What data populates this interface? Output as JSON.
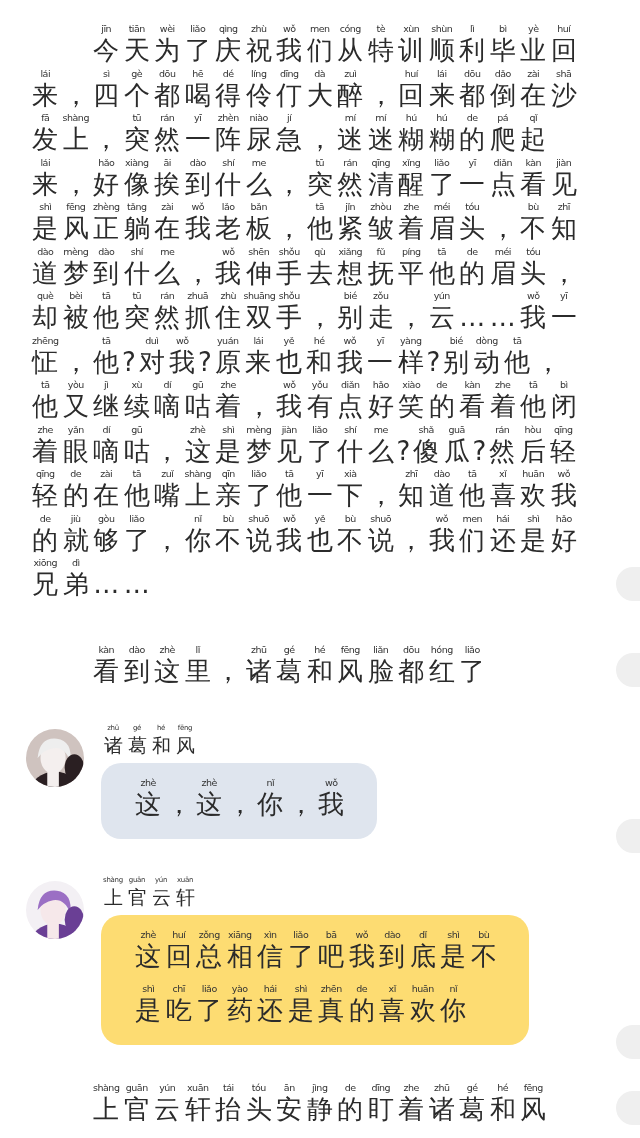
{
  "blocks": [
    {
      "kind": "narration",
      "lines": [
        {
          "pinyin": "jīn tiān wèi liǎo qìng zhù wǒ men cóng tè xùn shùn lì bì yè huí",
          "text": "今天为了庆祝我们从特训顺利毕业回"
        },
        {
          "pinyin": "lái sì gè dōu hē dé líng dīng dà zuì huí lái dōu dǎo zài shā",
          "text": "来，四个都喝得伶仃大醉，回来都倒在沙"
        },
        {
          "pinyin": "fā shàng tū rán yī zhèn niào jí mí mí hú hú de pá qǐ",
          "text": "发上，突然一阵尿急，迷迷糊糊的爬起"
        },
        {
          "pinyin": "lái hǎo xiàng āi dào shí me tū rán qīng xǐng liǎo yī diǎn kàn jiàn",
          "text": "来，好像挨到什么，突然清醒了一点看见"
        },
        {
          "pinyin": "shì fēng zhèng tǎng zài wǒ lǎo bǎn tā jǐn zhòu zhe méi tóu bù zhī",
          "text": "是风正躺在我老板，他紧皱着眉头，不知"
        },
        {
          "pinyin": "dào mèng dào shí me wǒ shēn shǒu qù xiǎng fǔ píng tā de méi tóu",
          "text": "道梦到什么，我伸手去想抚平他的眉头，"
        },
        {
          "pinyin": "què bèi tā tū rán zhuā zhù shuāng shǒu bié zǒu yún wǒ yī",
          "text": "却被他突然抓住双手，别走，云……我一"
        },
        {
          "pinyin": "zhēng tā duì wǒ yuán lái yě hé wǒ yī yàng bié dòng tā",
          "text": "怔，他?对我?原来也和我一样?别动他，"
        },
        {
          "pinyin": "tā yòu jì xù dí gū zhe wǒ yǒu diǎn hǎo xiào de kàn zhe tā bì",
          "text": "他又继续嘀咕着，我有点好笑的看着他闭"
        },
        {
          "pinyin": "zhe yǎn dí gū zhè shì mèng jiàn liǎo shí me shǎ guā rán hòu qīng",
          "text": "着眼嘀咕，这是梦见了什么?傻瓜?然后轻"
        },
        {
          "pinyin": "qīng de zài tā zuǐ shàng qīn liǎo tā yī xià zhī dào tā xǐ huān wǒ",
          "text": "轻的在他嘴上亲了他一下，知道他喜欢我"
        },
        {
          "pinyin": "de jiù gòu liǎo nǐ bù shuō wǒ yě bù shuō wǒ men hái shì hǎo",
          "text": "的就够了，你不说我也不说，我们还是好"
        },
        {
          "pinyin": "xiōng dì",
          "text": "兄弟……"
        }
      ]
    },
    {
      "kind": "narration",
      "lines": [
        {
          "pinyin": "kàn dào zhè lǐ zhū gé hé fēng liǎn dōu hóng liǎo",
          "text": "看到这里，诸葛和风脸都红了"
        }
      ]
    },
    {
      "kind": "message",
      "speaker": {
        "pinyin": "zhū gé hé fēng",
        "text": "诸葛和风"
      },
      "color": "#dfe5ee",
      "lines": [
        {
          "pinyin": "zhè zhè nǐ wǒ",
          "text": "这，这，你，我"
        }
      ]
    },
    {
      "kind": "message",
      "speaker": {
        "pinyin": "shàng guān yún xuān",
        "text": "上官云轩"
      },
      "color": "#fddc72",
      "lines": [
        {
          "pinyin": "zhè huí zǒng xiāng xìn liǎo bā wǒ dào dǐ shì bù",
          "text": "这回总相信了吧我到底是不"
        },
        {
          "pinyin": "shì chī liǎo yào hái shì zhēn de xǐ huān nǐ",
          "text": "是吃了药还是真的喜欢你"
        }
      ]
    },
    {
      "kind": "narration",
      "lines": [
        {
          "pinyin": "shàng guān yún xuān tái tóu ān jìng de dīng zhe zhū gé hé fēng",
          "text": "上官云轩抬头安静的盯着诸葛和风"
        }
      ]
    }
  ]
}
